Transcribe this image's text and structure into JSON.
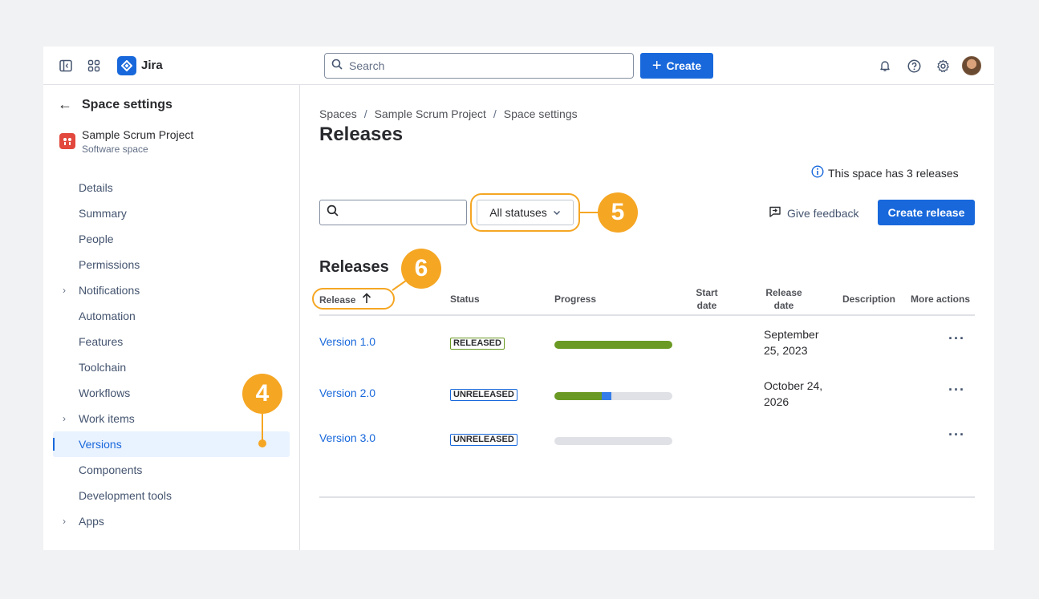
{
  "app": {
    "name": "Jira"
  },
  "search": {
    "placeholder": "Search"
  },
  "topbar": {
    "create_label": "Create"
  },
  "sidebar": {
    "title": "Space settings",
    "project_name": "Sample Scrum Project",
    "project_type": "Software space",
    "items": [
      {
        "label": "Details",
        "expandable": false,
        "active": false
      },
      {
        "label": "Summary",
        "expandable": false,
        "active": false
      },
      {
        "label": "People",
        "expandable": false,
        "active": false
      },
      {
        "label": "Permissions",
        "expandable": false,
        "active": false
      },
      {
        "label": "Notifications",
        "expandable": true,
        "active": false
      },
      {
        "label": "Automation",
        "expandable": false,
        "active": false
      },
      {
        "label": "Features",
        "expandable": false,
        "active": false
      },
      {
        "label": "Toolchain",
        "expandable": false,
        "active": false
      },
      {
        "label": "Workflows",
        "expandable": false,
        "active": false
      },
      {
        "label": "Work items",
        "expandable": true,
        "active": false
      },
      {
        "label": "Versions",
        "expandable": false,
        "active": true
      },
      {
        "label": "Components",
        "expandable": false,
        "active": false
      },
      {
        "label": "Development tools",
        "expandable": false,
        "active": false
      },
      {
        "label": "Apps",
        "expandable": true,
        "active": false
      }
    ]
  },
  "breadcrumb": [
    "Spaces",
    "Sample Scrum Project",
    "Space settings"
  ],
  "page": {
    "title": "Releases",
    "info": "This space has 3 releases",
    "status_filter": "All statuses",
    "feedback_label": "Give feedback",
    "create_release_label": "Create release",
    "section_title": "Releases"
  },
  "table": {
    "headers": {
      "release": "Release",
      "status": "Status",
      "progress": "Progress",
      "start_date": "Start date",
      "release_date": "Release date",
      "description": "Description",
      "more_actions": "More actions"
    },
    "rows": [
      {
        "name": "Version 1.0",
        "status": "RELEASED",
        "progress": {
          "done": 1.0,
          "in_progress": 0.0
        },
        "start_date": "",
        "release_date": "September 25, 2023",
        "description": ""
      },
      {
        "name": "Version 2.0",
        "status": "UNRELEASED",
        "progress": {
          "done": 0.4,
          "in_progress": 0.08
        },
        "start_date": "",
        "release_date": "October 24, 2026",
        "description": ""
      },
      {
        "name": "Version 3.0",
        "status": "UNRELEASED",
        "progress": {
          "done": 0.0,
          "in_progress": 0.0
        },
        "start_date": "",
        "release_date": "",
        "description": ""
      }
    ]
  },
  "callouts": {
    "a": "4",
    "b": "5",
    "c": "6"
  },
  "colors": {
    "brand": "#1868db",
    "callout": "#f5a623",
    "done": "#6a9a23",
    "in_progress": "#357de8"
  }
}
